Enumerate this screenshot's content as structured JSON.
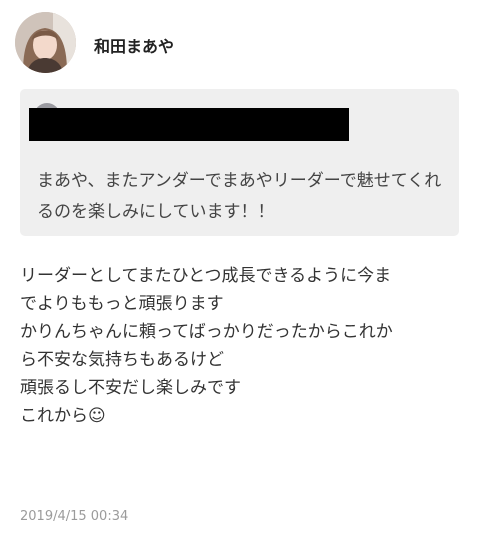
{
  "post": {
    "author": "和田まあや",
    "quote_text": "まあや、またアンダーでまあやリーダーで魅せてくれるのを楽しみにしています！！",
    "body_lines": [
      "リーダーとしてまたひとつ成長できるように今ま",
      "でよりももっと頑張ります",
      "かりんちゃんに頼ってばっかりだったからこれか",
      "ら不安な気持ちもあるけど",
      "頑張るし不安だし楽しみです",
      "これから☺"
    ],
    "timestamp": "2019/4/15 00:34"
  },
  "colors": {
    "quote_background": "#efefef",
    "timestamp": "#9b9b9b",
    "redaction": "#000000"
  },
  "icons": {
    "author_avatar": "author-avatar-photo",
    "quoted_user_avatar": "quoted-user-avatar"
  }
}
